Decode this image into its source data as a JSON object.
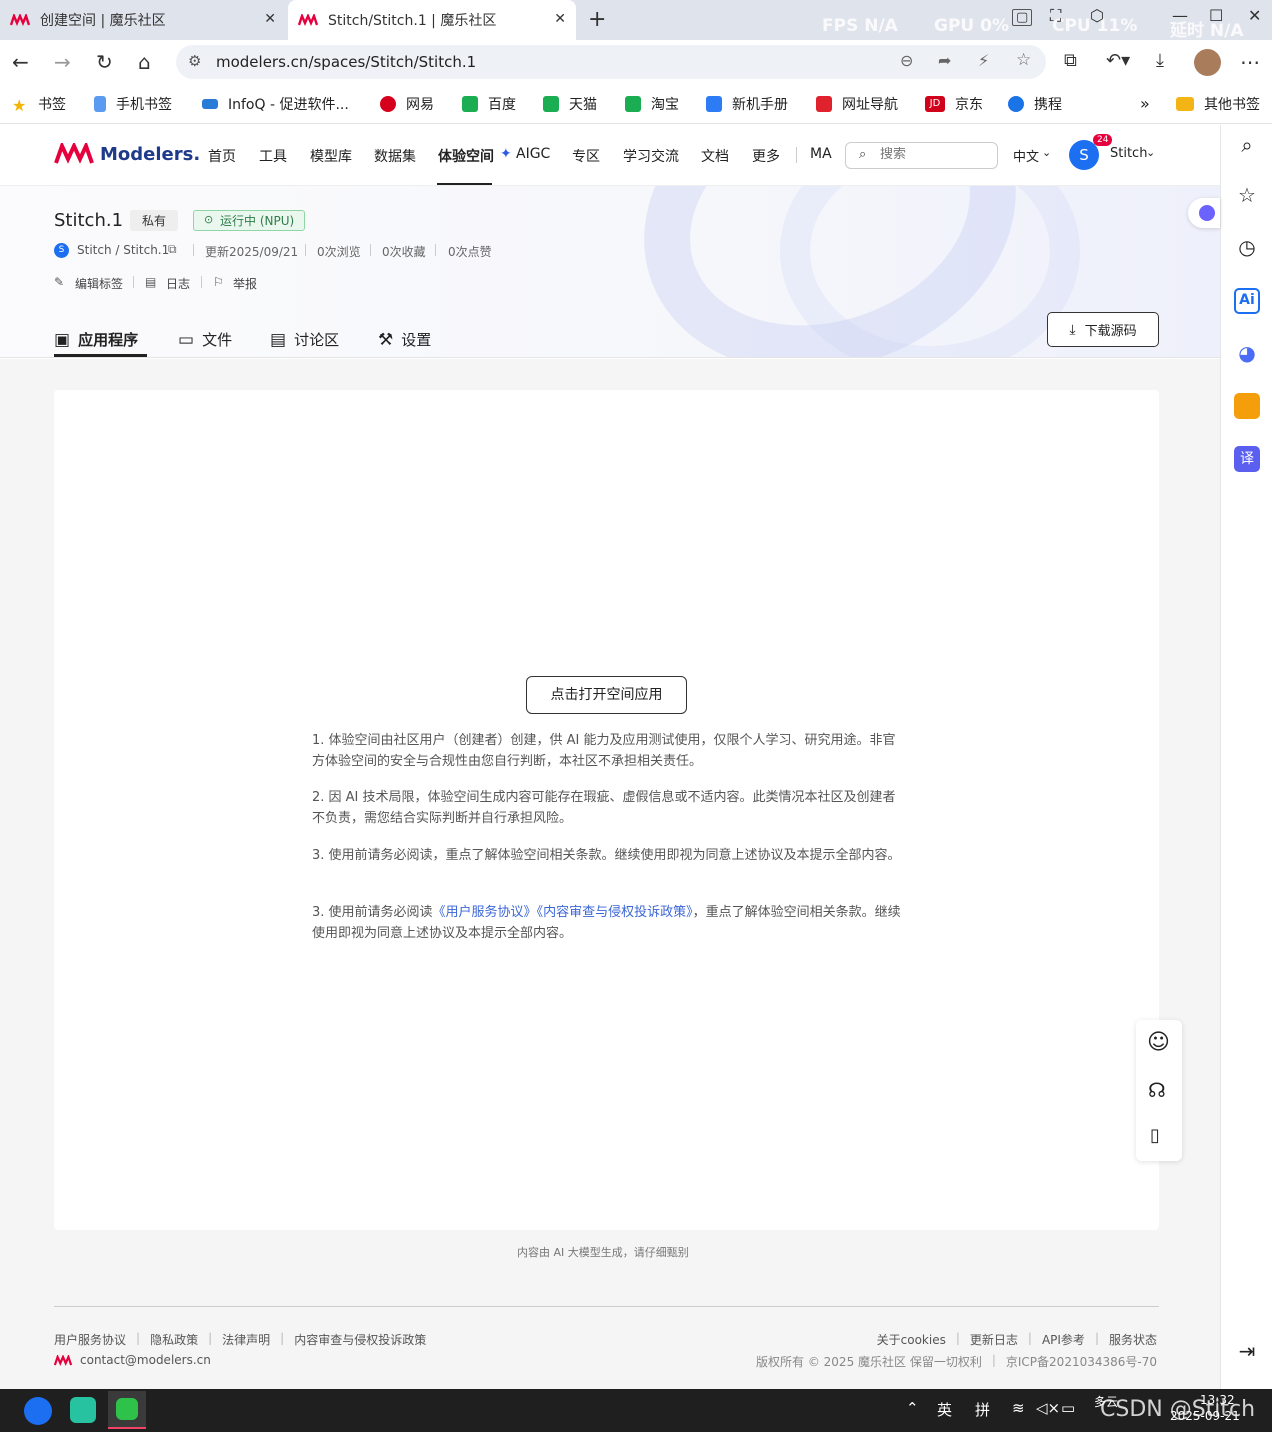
{
  "browser": {
    "tabs": [
      {
        "title": "创建空间 | 魔乐社区"
      },
      {
        "title": "Stitch/Stitch.1 | 魔乐社区"
      }
    ],
    "new_tab": "+",
    "overlay": {
      "fps": "FPS N/A",
      "gpu": "GPU 0%",
      "cpu": "CPU 11%",
      "latency": "延时 N/A"
    },
    "url": "modelers.cn/spaces/Stitch/Stitch.1",
    "bookmarks": [
      "书签",
      "手机书签",
      "InfoQ - 促进软件...",
      "网易",
      "百度",
      "天猫",
      "淘宝",
      "新机手册",
      "网址导航",
      "京东",
      "携程"
    ],
    "bookmarks_more": "»",
    "other_bookmarks": "其他书签",
    "colors": {
      "tabstrip": "#dfe3eb",
      "accent": "#e6003d"
    }
  },
  "site": {
    "logo_text": "Modelers.",
    "nav": [
      "首页",
      "工具",
      "模型库",
      "数据集",
      "体验空间",
      "AIGC",
      "专区",
      "学习交流",
      "文档",
      "更多",
      "MA"
    ],
    "active_nav": "体验空间",
    "search_placeholder": "搜索",
    "language": "中文",
    "user_initial": "S",
    "user_name": "Stitch",
    "notification_count": "24"
  },
  "space": {
    "title": "Stitch.1",
    "visibility": "私有",
    "status": "运行中 (NPU)",
    "owner_initial": "S",
    "path": "Stitch / Stitch.1",
    "updated": "更新2025/09/21",
    "views": "0次浏览",
    "favorites": "0次收藏",
    "likes": "0次点赞",
    "actions": [
      "编辑标签",
      "日志",
      "举报"
    ],
    "tabs": [
      "应用程序",
      "文件",
      "讨论区",
      "设置"
    ],
    "active_tab": "应用程序",
    "download_label": "下载源码"
  },
  "app": {
    "open_button": "点击打开空间应用",
    "notes": [
      "1. 体验空间由社区用户（创建者）创建，供 AI 能力及应用测试使用，仅限个人学习、研究用途。非官方体验空间的安全与合规性由您自行判断，本社区不承担相关责任。",
      "2. 因 AI 技术局限，体验空间生成内容可能存在瑕疵、虚假信息或不适内容。此类情况本社区及创建者不负责，需您结合实际判断并自行承担风险。",
      "3. 使用前请务必阅读，重点了解体验空间相关条款。继续使用即视为同意上述协议及本提示全部内容。"
    ],
    "note4_prefix": "3. 使用前请务必阅读",
    "note4_link1": "《用户服务协议》",
    "note4_link2": "《内容审查与侵权投诉政策》",
    "note4_suffix": "，重点了解体验空间相关条款。继续使用即视为同意上述协议及本提示全部内容。",
    "ai_notice": "内容由 AI 大模型生成，请仔细甄别"
  },
  "footer": {
    "left_links": [
      "用户服务协议",
      "隐私政策",
      "法律声明",
      "内容审查与侵权投诉政策"
    ],
    "right_links": [
      "关于cookies",
      "更新日志",
      "API参考",
      "服务状态"
    ],
    "contact": "contact@modelers.cn",
    "copyright": "版权所有 © 2025 魔乐社区 保留一切权利",
    "icp": "京ICP备2021034386号-70"
  },
  "taskbar": {
    "ime_en": "英",
    "ime_pinyin": "拼",
    "weather": "多云",
    "clock": "13:32",
    "date": "2025-09-21",
    "watermark": "CSDN @Stitch"
  }
}
